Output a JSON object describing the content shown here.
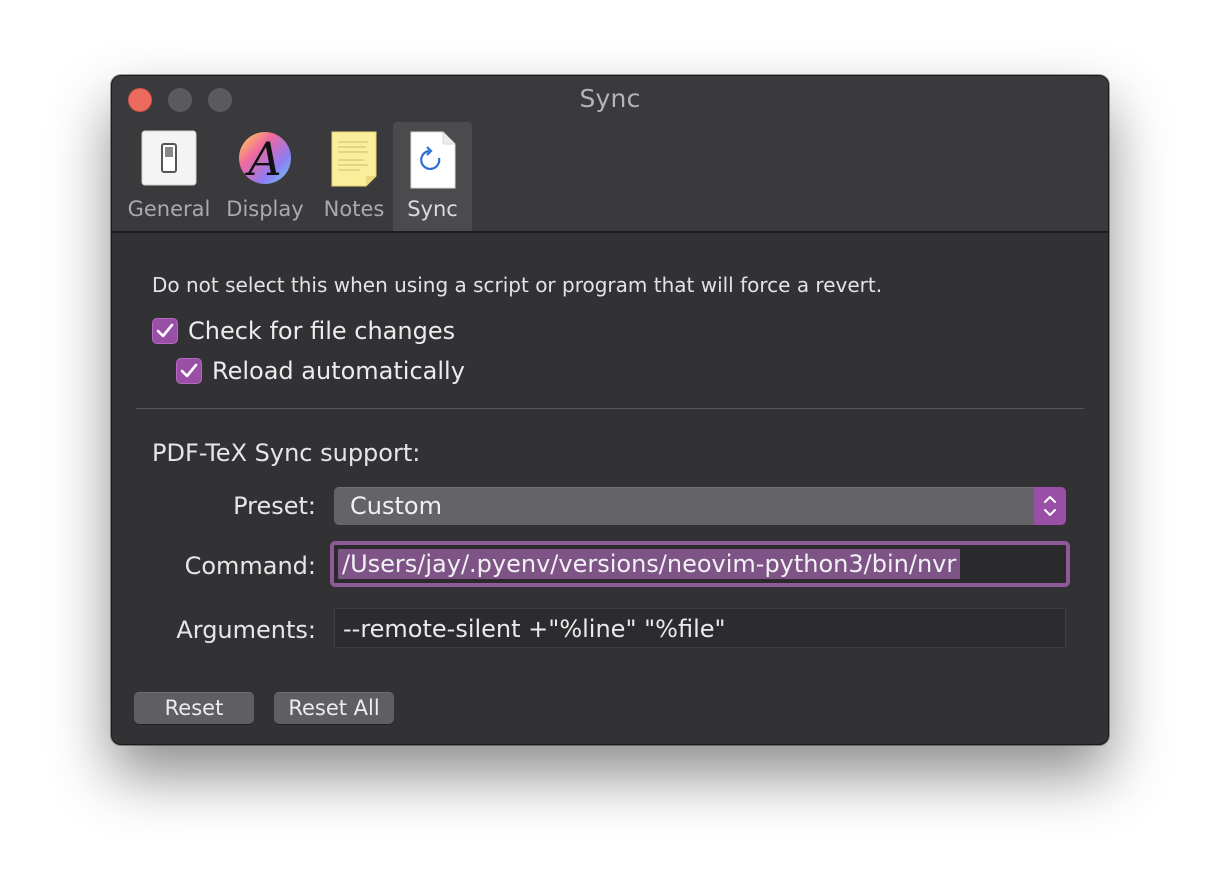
{
  "window": {
    "title": "Sync"
  },
  "toolbar": {
    "items": [
      {
        "label": "General",
        "icon": "switch-icon"
      },
      {
        "label": "Display",
        "icon": "font-color-wheel-icon"
      },
      {
        "label": "Notes",
        "icon": "note-paper-icon"
      },
      {
        "label": "Sync",
        "icon": "sync-document-icon",
        "selected": true
      }
    ]
  },
  "content": {
    "info_text": "Do not select this when using a script or program that will force a revert.",
    "check_file_changes": {
      "label": "Check for file changes",
      "checked": true
    },
    "reload_automatically": {
      "label": "Reload automatically",
      "checked": true
    },
    "sync_title": "PDF-TeX Sync support:",
    "preset": {
      "label": "Preset:",
      "value": "Custom"
    },
    "command": {
      "label": "Command:",
      "value": "/Users/jay/.pyenv/versions/neovim-python3/bin/nvr"
    },
    "arguments": {
      "label": "Arguments:",
      "value": "--remote-silent +\"%line\" \"%file\""
    },
    "buttons": {
      "reset": "Reset",
      "reset_all": "Reset All"
    }
  },
  "colors": {
    "accent": "#9a4fa6",
    "close": "#ed6a5e",
    "window_bg": "#323234"
  }
}
